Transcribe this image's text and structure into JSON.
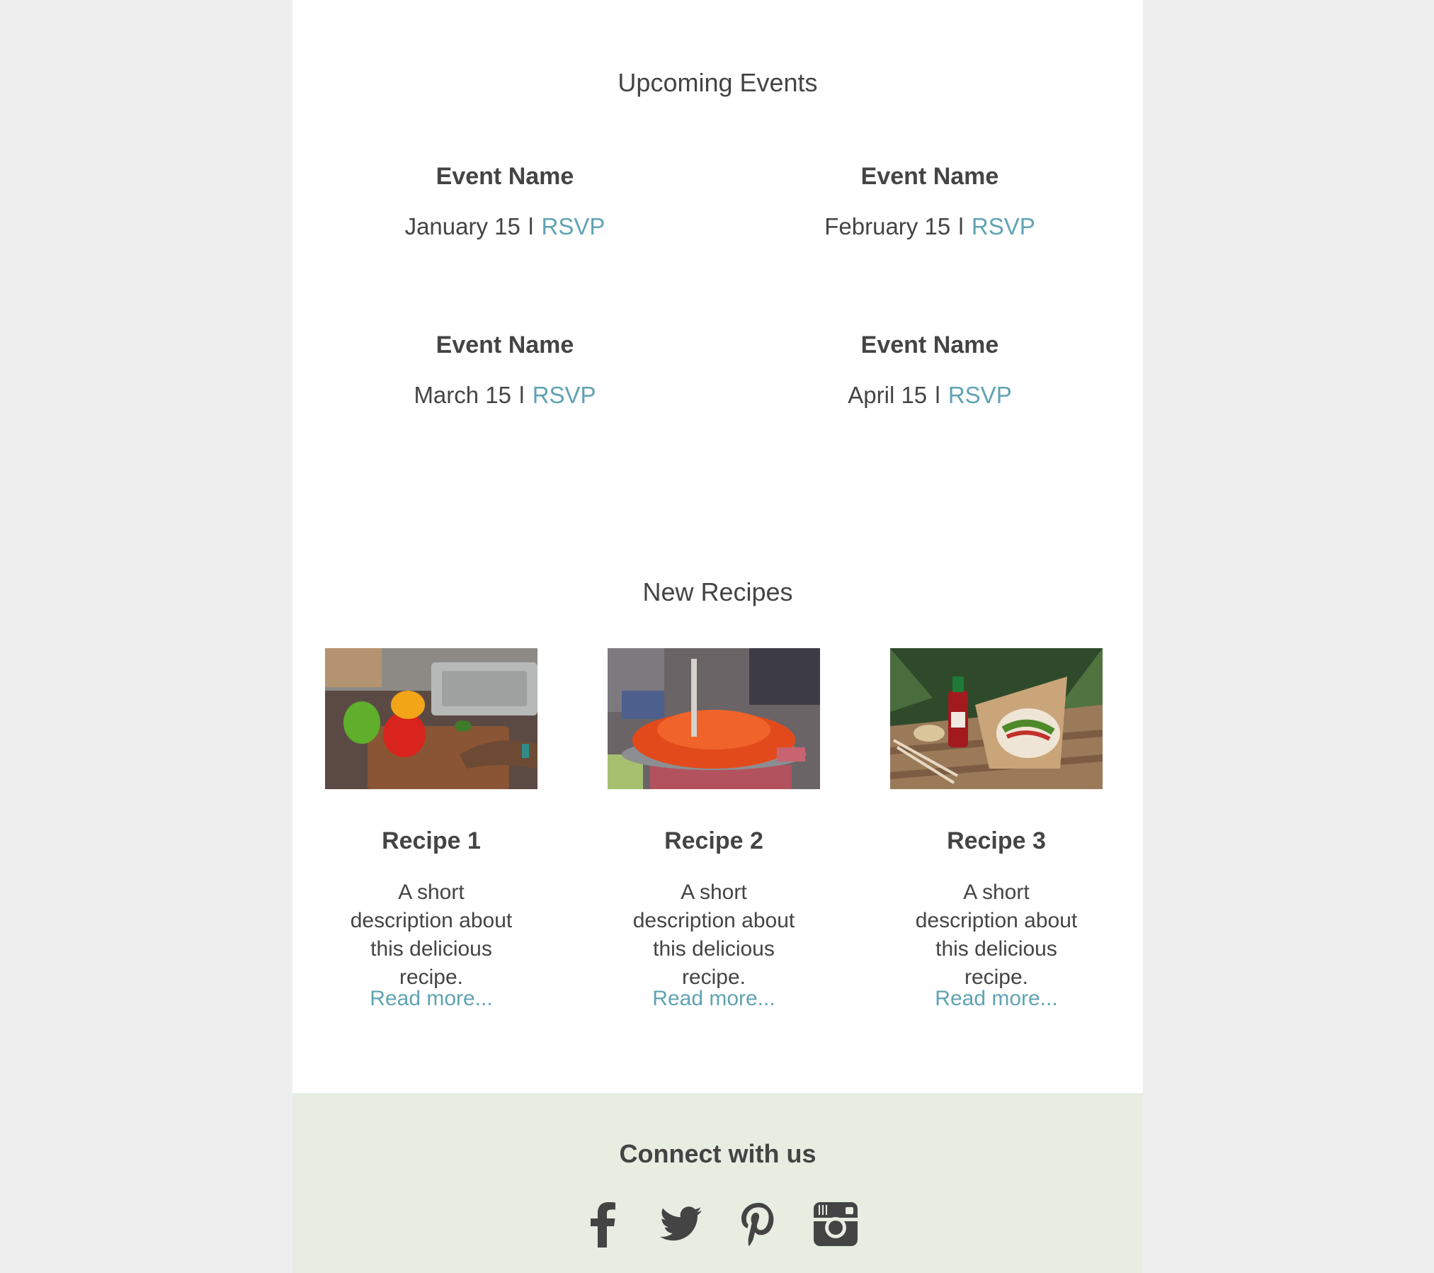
{
  "events": {
    "title": "Upcoming Events",
    "separator": "l",
    "items": [
      {
        "name": "Event Name",
        "date": "January 15",
        "rsvp": "RSVP"
      },
      {
        "name": "Event Name",
        "date": "February 15",
        "rsvp": "RSVP"
      },
      {
        "name": "Event Name",
        "date": "March 15",
        "rsvp": "RSVP"
      },
      {
        "name": "Event Name",
        "date": "April 15",
        "rsvp": "RSVP"
      }
    ]
  },
  "recipes": {
    "title": "New Recipes",
    "items": [
      {
        "name": "Recipe 1",
        "description": "A short description about this delicious recipe.",
        "link": "Read more..."
      },
      {
        "name": "Recipe 2",
        "description": "A short description about this delicious recipe.",
        "link": "Read more..."
      },
      {
        "name": "Recipe 3",
        "description": "A short description about this delicious recipe.",
        "link": "Read more..."
      }
    ]
  },
  "footer": {
    "title": "Connect with us",
    "social": [
      "facebook-icon",
      "twitter-icon",
      "pinterest-icon",
      "instagram-icon"
    ]
  },
  "colors": {
    "background": "#efeeef",
    "content": "#ffffff",
    "text": "#444444",
    "link": "#5fa3b3",
    "footer": "#e8ede2"
  }
}
